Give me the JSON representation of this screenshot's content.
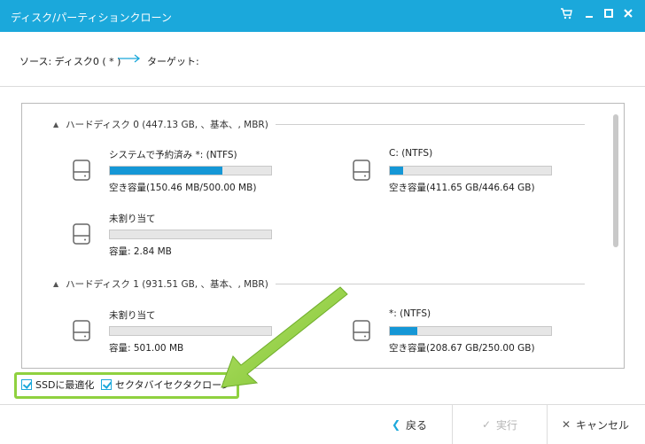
{
  "window": {
    "title": "ディスク/パーティションクローン",
    "controls": [
      "cart-icon",
      "minimize-icon",
      "maximize-icon",
      "close-icon"
    ]
  },
  "path": {
    "source": "ソース:  ディスク0 ( * )",
    "target": "ターゲット:"
  },
  "disks": [
    {
      "header": "ハードディスク 0 (447.13 GB, 、基本、, MBR)",
      "partitions": [
        {
          "name": "システムで予約済み *: (NTFS)",
          "info": "空き容量(150.46 MB/500.00 MB)",
          "used_fraction": 0.7
        },
        {
          "name": "C: (NTFS)",
          "info": "空き容量(411.65 GB/446.64 GB)",
          "used_fraction": 0.08
        },
        {
          "name": "未割り当て",
          "info": "容量: 2.84 MB",
          "used_fraction": 0
        }
      ]
    },
    {
      "header": "ハードディスク 1 (931.51 GB, 、基本、, MBR)",
      "partitions": [
        {
          "name": "未割り当て",
          "info": "容量: 501.00 MB",
          "used_fraction": 0
        },
        {
          "name": "*: (NTFS)",
          "info": "空き容量(208.67 GB/250.00 GB)",
          "used_fraction": 0.17
        }
      ]
    }
  ],
  "options": {
    "ssd_label": "SSDに最適化",
    "sector_label": "セクタバイセクタクローン"
  },
  "footer": {
    "back_label": "戻る",
    "execute_label": "実行",
    "cancel_label": "キャンセル"
  },
  "colors": {
    "accent": "#1ba8db",
    "bar_fill": "#1597d6",
    "highlight": "#8fd13f",
    "disabled": "#b5b5b5"
  }
}
